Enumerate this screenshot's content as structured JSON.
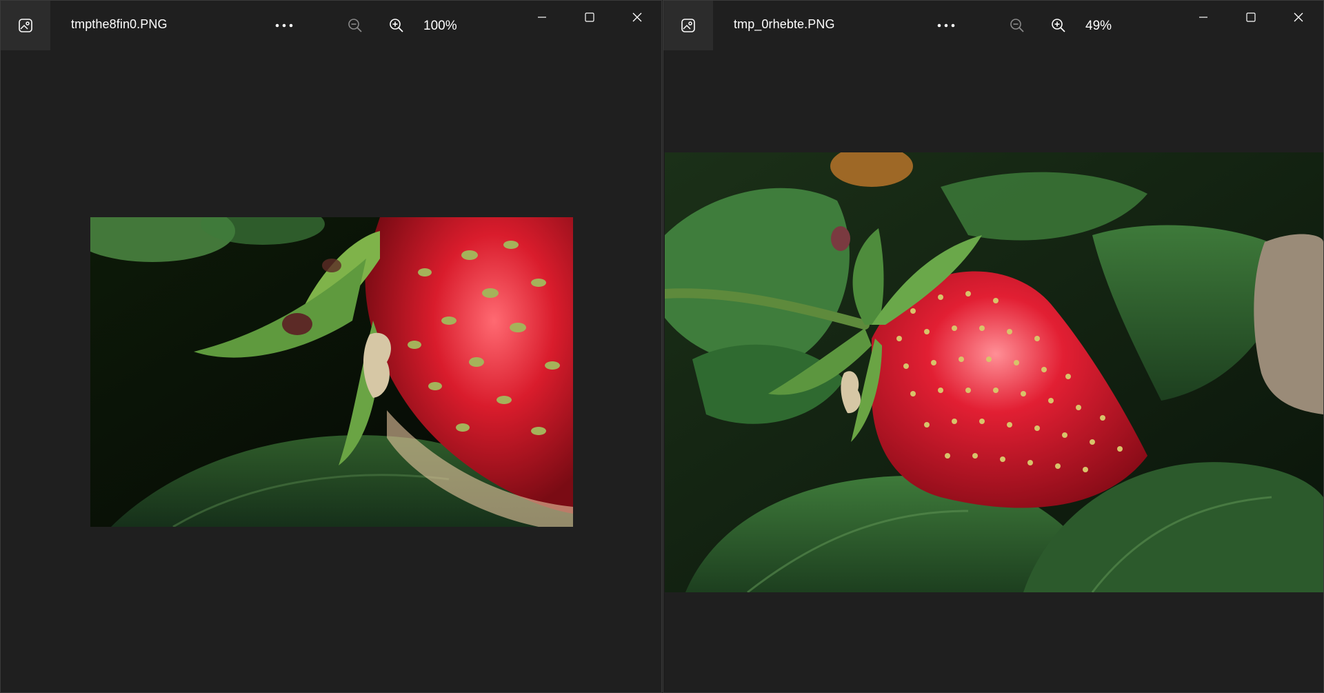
{
  "windows": [
    {
      "file_name": "tmpthe8fin0.PNG",
      "zoom": "100%",
      "more_label": "•••"
    },
    {
      "file_name": "tmp_0rhebte.PNG",
      "zoom": "49%",
      "more_label": "•••"
    }
  ],
  "icons": {
    "app": "photos-app-icon",
    "more": "more-options-icon",
    "zoom_out": "zoom-out-icon",
    "zoom_in": "zoom-in-icon",
    "minimize": "minimize-icon",
    "maximize": "maximize-icon",
    "close": "close-icon"
  },
  "colors": {
    "background": "#1f1f1f",
    "titlebar_icon_bg": "#2c2c2c",
    "text": "#ffffff",
    "disabled_icon": "#8a8a8a"
  }
}
